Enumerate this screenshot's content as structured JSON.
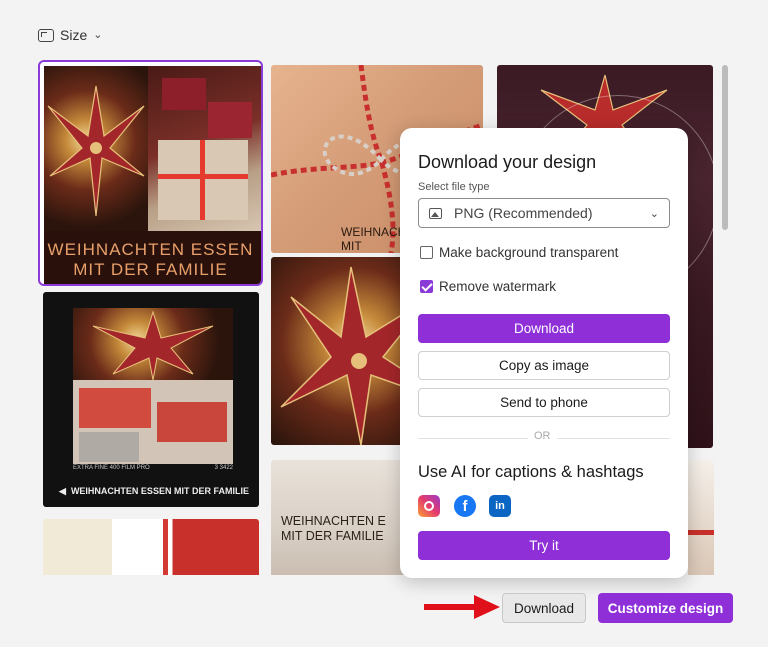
{
  "toolbar": {
    "size_label": "Size"
  },
  "tiles": {
    "tile1_caption": "WEIHNACHTEN ESSEN\nMIT DER FAMILIE",
    "tile4_caption": "WEIHNACHTEN ESSEN MIT DER FAMILIE",
    "tile4_film_top": "EXTRA FINE 400 FILM PRO",
    "tile4_film_nums": "3          3422",
    "tile6_caption": "WEIHNACHTEN E\nMIT DER FAMILIE",
    "tile2_caption": "WEIHNACHTEN\nMIT"
  },
  "popup": {
    "title": "Download your design",
    "file_type_label": "Select file type",
    "file_type_value": "PNG (Recommended)",
    "transparent_label": "Make background transparent",
    "transparent_checked": false,
    "watermark_label": "Remove watermark",
    "watermark_checked": true,
    "download_label": "Download",
    "copy_label": "Copy as image",
    "phone_label": "Send to phone",
    "or_label": "OR",
    "ai_title": "Use AI for captions & hashtags",
    "try_label": "Try it",
    "social": [
      "instagram-icon",
      "facebook-icon",
      "linkedin-icon"
    ]
  },
  "footer": {
    "download_label": "Download",
    "customize_label": "Customize design"
  },
  "colors": {
    "accent": "#8e2fd8",
    "arrow": "#e0101a"
  }
}
